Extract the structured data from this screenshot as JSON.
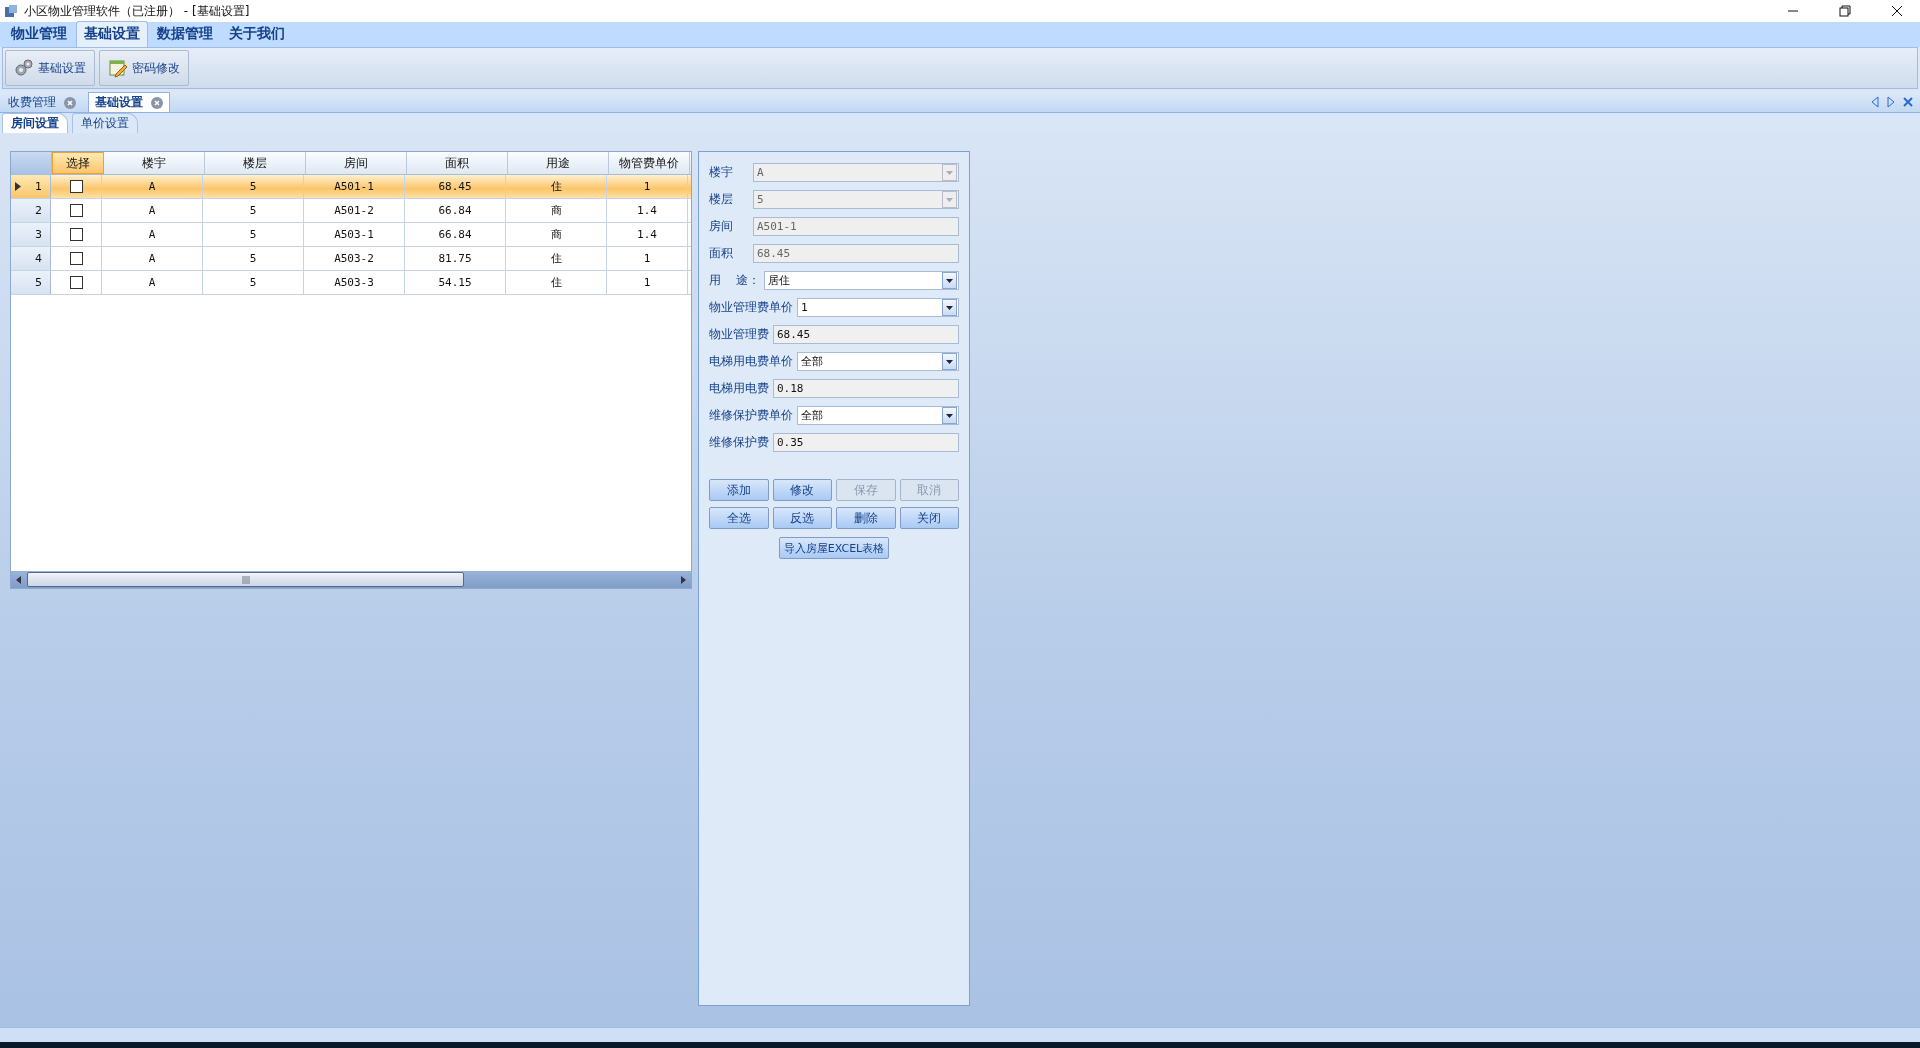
{
  "window": {
    "title": "小区物业管理软件（已注册） - [基础设置]"
  },
  "menu": [
    {
      "label": "物业管理",
      "selected": false
    },
    {
      "label": "基础设置",
      "selected": true
    },
    {
      "label": "数据管理",
      "selected": false
    },
    {
      "label": "关于我们",
      "selected": false
    }
  ],
  "toolbar": [
    {
      "label": "基础设置",
      "kind": "gears"
    },
    {
      "label": "密码修改",
      "kind": "edit"
    }
  ],
  "doc_tabs": [
    {
      "label": "收费管理",
      "selected": false
    },
    {
      "label": "基础设置",
      "selected": true
    }
  ],
  "sub_tabs": [
    {
      "label": "房间设置",
      "selected": true
    },
    {
      "label": "单价设置",
      "selected": false
    }
  ],
  "table": {
    "columns": [
      "选择",
      "楼宇",
      "楼层",
      "房间",
      "面积",
      "用途",
      "物管费单价"
    ],
    "rows": [
      {
        "index": "1",
        "selected": true,
        "cells": [
          {
            "kind": "checkbox",
            "checked": false
          },
          "A",
          "5",
          "A501-1",
          "68.45",
          "住",
          "1"
        ]
      },
      {
        "index": "2",
        "selected": false,
        "cells": [
          {
            "kind": "checkbox",
            "checked": false
          },
          "A",
          "5",
          "A501-2",
          "66.84",
          "商",
          "1.4"
        ]
      },
      {
        "index": "3",
        "selected": false,
        "cells": [
          {
            "kind": "checkbox",
            "checked": false
          },
          "A",
          "5",
          "A503-1",
          "66.84",
          "商",
          "1.4"
        ]
      },
      {
        "index": "4",
        "selected": false,
        "cells": [
          {
            "kind": "checkbox",
            "checked": false
          },
          "A",
          "5",
          "A503-2",
          "81.75",
          "住",
          "1"
        ]
      },
      {
        "index": "5",
        "selected": false,
        "cells": [
          {
            "kind": "checkbox",
            "checked": false
          },
          "A",
          "5",
          "A503-3",
          "54.15",
          "住",
          "1"
        ]
      }
    ]
  },
  "form": {
    "fields": [
      {
        "label": "楼宇",
        "kind": "combo",
        "value": "A",
        "disabled": true
      },
      {
        "label": "楼层",
        "kind": "combo",
        "value": "5",
        "disabled": true
      },
      {
        "label": "房间",
        "kind": "text",
        "value": "A501-1",
        "disabled": true
      },
      {
        "label": "面积",
        "kind": "text",
        "value": "68.45",
        "disabled": true
      },
      {
        "label": "用    途：",
        "kind": "combo",
        "value": "居住",
        "disabled": false
      },
      {
        "label": "物业管理费单价",
        "kind": "combo",
        "value": "1",
        "disabled": false
      },
      {
        "label": "物业管理费",
        "kind": "text",
        "value": "68.45",
        "disabled": false
      },
      {
        "label": "电梯用电费单价",
        "kind": "combo",
        "value": "全部",
        "disabled": false
      },
      {
        "label": "电梯用电费",
        "kind": "text",
        "value": "0.18",
        "disabled": false
      },
      {
        "label": "维修保护费单价",
        "kind": "combo",
        "value": "全部",
        "disabled": false
      },
      {
        "label": "维修保护费",
        "kind": "text",
        "value": "0.35",
        "disabled": false
      }
    ],
    "buttons": [
      {
        "label": "添加",
        "disabled": false
      },
      {
        "label": "修改",
        "disabled": false
      },
      {
        "label": "保存",
        "disabled": true
      },
      {
        "label": "取消",
        "disabled": true
      },
      {
        "label": "全选",
        "disabled": false
      },
      {
        "label": "反选",
        "disabled": false
      },
      {
        "label": "删除",
        "disabled": false
      },
      {
        "label": "关闭",
        "disabled": false
      }
    ],
    "import_button": "导入房屋EXCEL表格"
  }
}
